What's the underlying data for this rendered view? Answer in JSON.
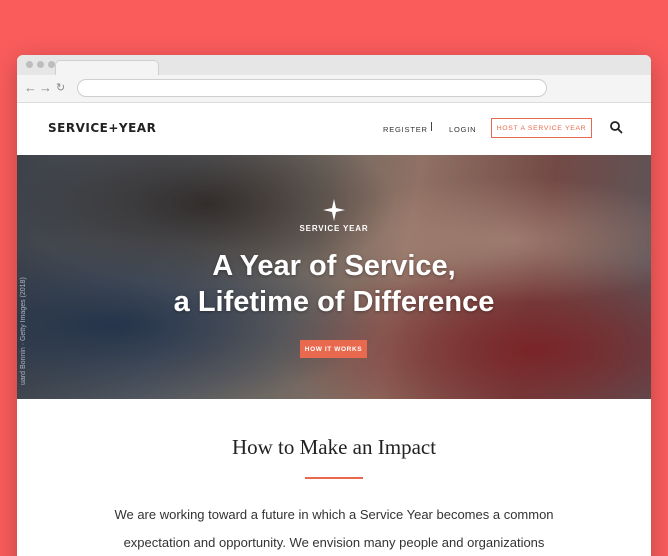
{
  "site": {
    "logo": "SERVICE+YEAR",
    "nav": {
      "register": "REGISTER",
      "separator": "|",
      "login": "LOGIN",
      "host": "HOST A SERVICE YEAR"
    }
  },
  "hero": {
    "eyebrow": "SERVICE YEAR",
    "headline_line1": "A Year of Service,",
    "headline_line2": "a Lifetime of Difference",
    "button": "HOW IT WORKS",
    "credit": "uard Bonnin · Getty Images (2018)"
  },
  "content": {
    "title": "How to Make an Impact",
    "paragraph_line1": "We are working toward a future in which a Service Year becomes a common",
    "paragraph_line2": "expectation and opportunity. We envision many people and organizations"
  },
  "colors": {
    "background": "#fa5c5c",
    "accent": "#e8694e"
  }
}
